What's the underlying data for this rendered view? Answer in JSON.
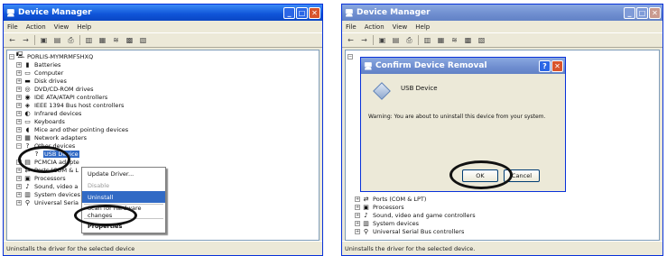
{
  "window1": {
    "title": "Device Manager",
    "menu": [
      "File",
      "Action",
      "View",
      "Help"
    ],
    "status": "Uninstalls the driver for the selected device"
  },
  "tree1": {
    "root": "PORLIS-MYMRMF5HXQ",
    "items": [
      "Batteries",
      "Computer",
      "Disk drives",
      "DVD/CD-ROM drives",
      "IDE ATA/ATAPI controllers",
      "IEEE 1394 Bus host controllers",
      "Infrared devices",
      "Keyboards",
      "Mice and other pointing devices",
      "Network adapters",
      "Other devices",
      "USB Device",
      "PCMCIA adapte",
      "Ports (COM & L",
      "Processors",
      "Sound, video a",
      "System devices",
      "Universal Seria"
    ]
  },
  "context_menu": {
    "items": [
      "Update Driver...",
      "Disable",
      "Uninstall",
      "Scan for hardware changes",
      "Properties"
    ]
  },
  "window2": {
    "title": "Device Manager",
    "menu": [
      "File",
      "Action",
      "View",
      "Help"
    ],
    "status": "Uninstalls the driver for the selected device."
  },
  "tree2": {
    "items": [
      "Ports (COM & LPT)",
      "Processors",
      "Sound, video and game controllers",
      "System devices",
      "Universal Serial Bus controllers"
    ]
  },
  "dialog": {
    "title": "Confirm Device Removal",
    "device": "USB Device",
    "warning": "Warning: You are about to uninstall this device from your system.",
    "ok": "OK",
    "cancel": "Cancel"
  },
  "colors": {
    "titlebar_active": "#0f54d8",
    "selection": "#316ac5",
    "window_bg": "#ece9d8"
  },
  "icons": {
    "app": "device-manager-icon",
    "computer": "computer-icon",
    "device": "device-icon",
    "warning": "usb-device-icon"
  }
}
